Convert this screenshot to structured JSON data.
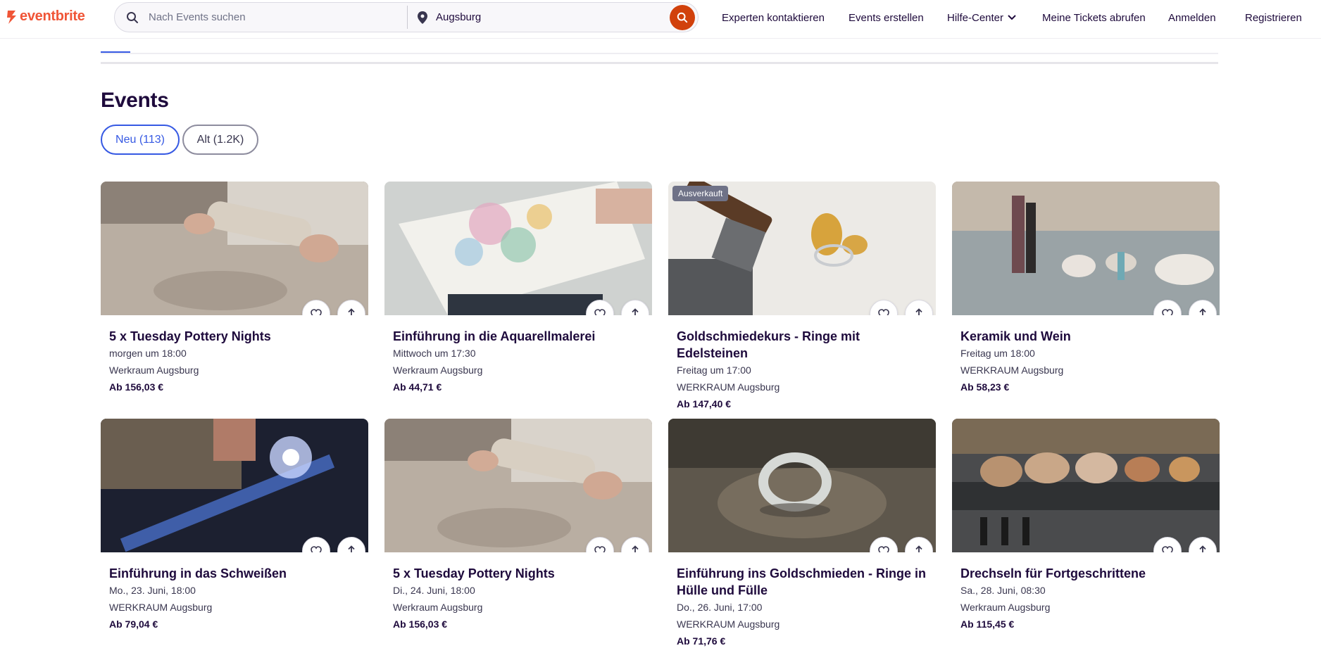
{
  "header": {
    "logo_text": "eventbrite",
    "search_placeholder": "Nach Events suchen",
    "location_value": "Augsburg",
    "nav": [
      "Experten kontaktieren",
      "Events erstellen",
      "Hilfe-Center",
      "Meine Tickets abrufen",
      "Anmelden",
      "Registrieren"
    ]
  },
  "section": {
    "title": "Events",
    "filters": [
      "Neu (113)",
      "Alt (1.2K)"
    ]
  },
  "events": [
    {
      "title": "5 x Tuesday Pottery Nights",
      "date": "morgen um 18:00",
      "venue": "Werkraum Augsburg",
      "price": "Ab 156,03 €",
      "badge": ""
    },
    {
      "title": "Einführung in die Aquarellmalerei",
      "date": "Mittwoch um 17:30",
      "venue": "Werkraum Augsburg",
      "price": "Ab 44,71 €",
      "badge": ""
    },
    {
      "title": "Goldschmiedekurs - Ringe mit Edelsteinen",
      "date": "Freitag um 17:00",
      "venue": "WERKRAUM Augsburg",
      "price": "Ab 147,40 €",
      "badge": "Ausverkauft"
    },
    {
      "title": "Keramik und Wein",
      "date": "Freitag um 18:00",
      "venue": "WERKRAUM Augsburg",
      "price": "Ab 58,23 €",
      "badge": ""
    },
    {
      "title": "Einführung in das Schweißen",
      "date": "Mo., 23. Juni, 18:00",
      "venue": "WERKRAUM Augsburg",
      "price": "Ab 79,04 €",
      "badge": ""
    },
    {
      "title": "5 x Tuesday Pottery Nights",
      "date": "Di., 24. Juni, 18:00",
      "venue": "Werkraum Augsburg",
      "price": "Ab 156,03 €",
      "badge": ""
    },
    {
      "title": "Einführung ins Goldschmieden - Ringe in Hülle und Fülle",
      "date": "Do., 26. Juni, 17:00",
      "venue": "WERKRAUM Augsburg",
      "price": "Ab 71,76 €",
      "badge": ""
    },
    {
      "title": "Drechseln für Fortgeschrittene",
      "date": "Sa., 28. Juni, 08:30",
      "venue": "Werkraum Augsburg",
      "price": "Ab 115,45 €",
      "badge": ""
    }
  ],
  "colors": {
    "brand": "#f05537",
    "search_button": "#d1410c",
    "accent": "#3659e3",
    "text": "#1e0a3c"
  },
  "icons": [
    "search-icon",
    "location-pin-icon",
    "chevron-down-icon",
    "heart-icon",
    "share-icon"
  ]
}
